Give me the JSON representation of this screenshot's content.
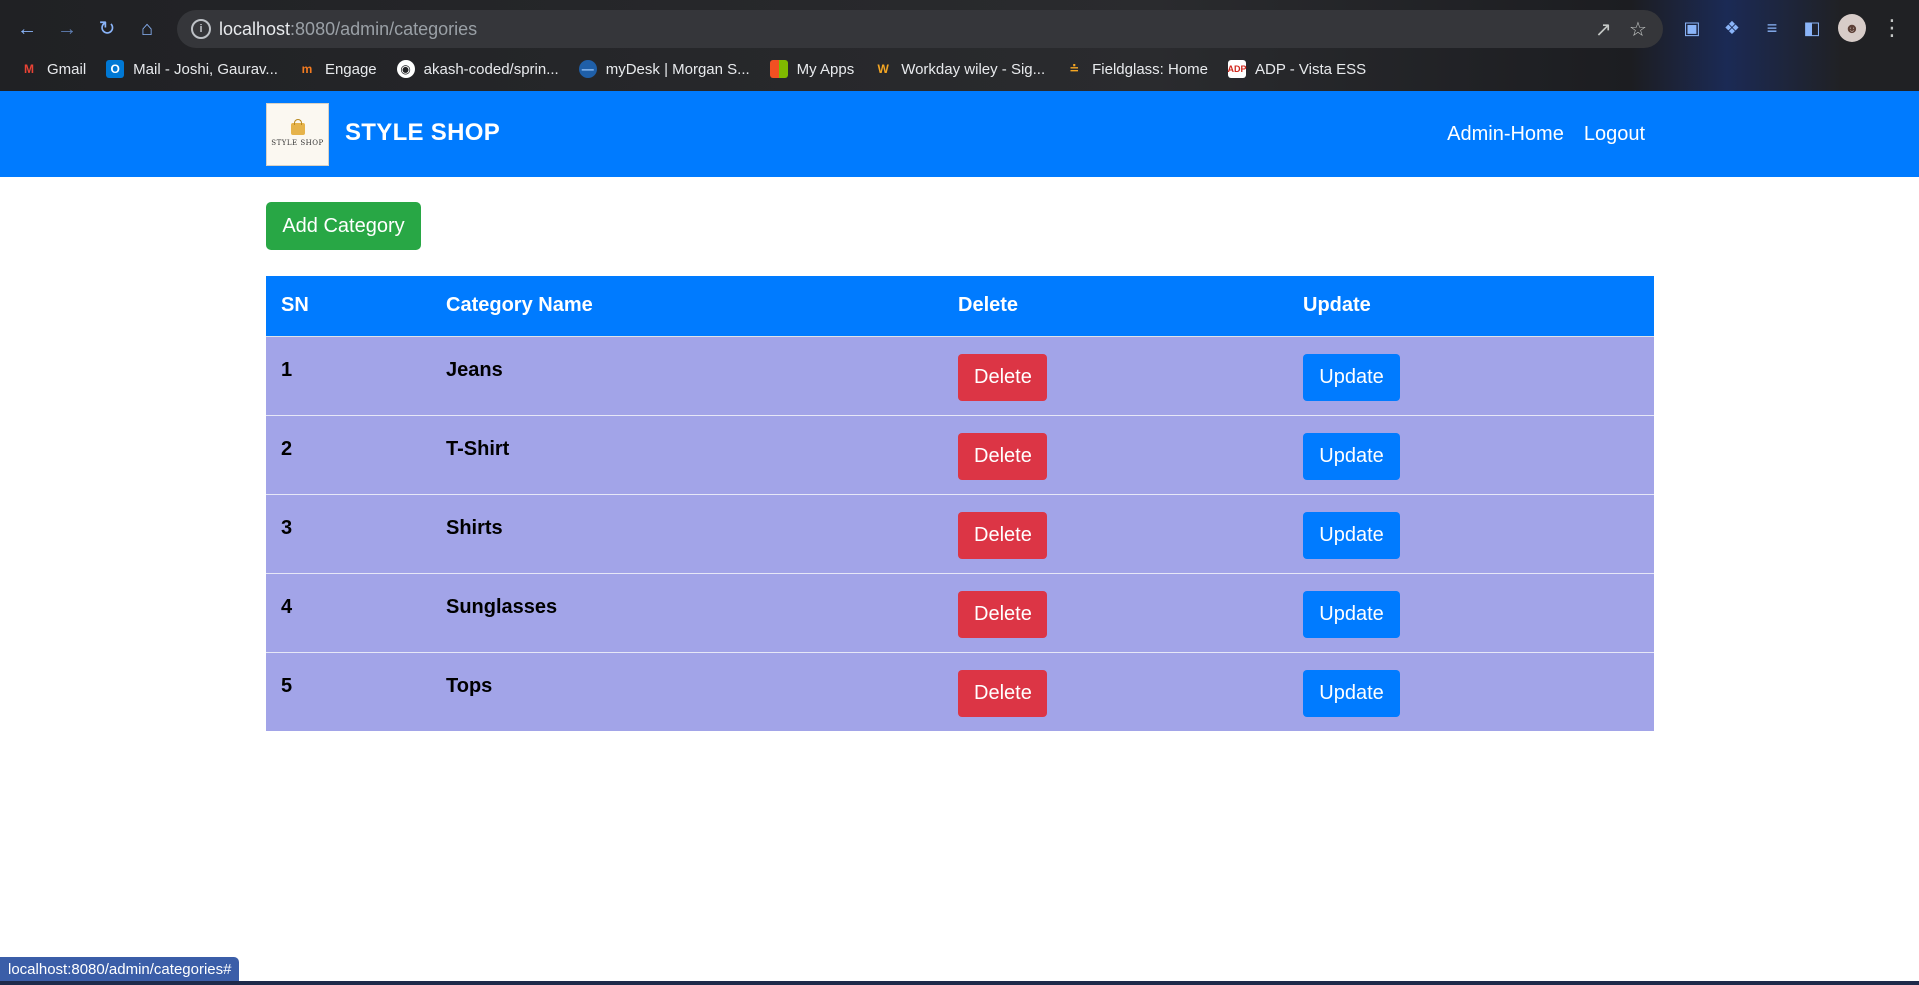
{
  "browser": {
    "url_host": "localhost",
    "url_path": ":8080/admin/categories",
    "bookmarks": [
      {
        "label": "Gmail",
        "icon": "gmail-icon",
        "color": "#ea4335"
      },
      {
        "label": "Mail - Joshi, Gaurav...",
        "icon": "outlook-icon",
        "color": "#0078d4"
      },
      {
        "label": "Engage",
        "icon": "engage-icon",
        "color": "#f47b20"
      },
      {
        "label": "akash-coded/sprin...",
        "icon": "github-icon",
        "color": "#ffffff"
      },
      {
        "label": "myDesk | Morgan S...",
        "icon": "mydesk-icon",
        "color": "#1f5fa8"
      },
      {
        "label": "My Apps",
        "icon": "microsoft-icon",
        "color": "#7fba00"
      },
      {
        "label": "Workday wiley - Sig...",
        "icon": "workday-icon",
        "color": "#f5a623"
      },
      {
        "label": "Fieldglass: Home",
        "icon": "fieldglass-icon",
        "color": "#f5a623"
      },
      {
        "label": "ADP - Vista ESS",
        "icon": "adp-icon",
        "color": "#d0271d"
      }
    ],
    "status_text": "localhost:8080/admin/categories#"
  },
  "navbar": {
    "logo_text": "STYLE SHOP",
    "brand": "STYLE SHOP",
    "links": [
      "Admin-Home",
      "Logout"
    ],
    "color": "#007bff"
  },
  "actions": {
    "add_label": "Add Category"
  },
  "table": {
    "headers": [
      "SN",
      "Category Name",
      "Delete",
      "Update"
    ],
    "rows": [
      {
        "sn": "1",
        "name": "Jeans"
      },
      {
        "sn": "2",
        "name": "T-Shirt"
      },
      {
        "sn": "3",
        "name": "Shirts"
      },
      {
        "sn": "4",
        "name": "Sunglasses"
      },
      {
        "sn": "5",
        "name": "Tops"
      }
    ],
    "delete_label": "Delete",
    "update_label": "Update",
    "row_color": "#a2a4e8"
  }
}
